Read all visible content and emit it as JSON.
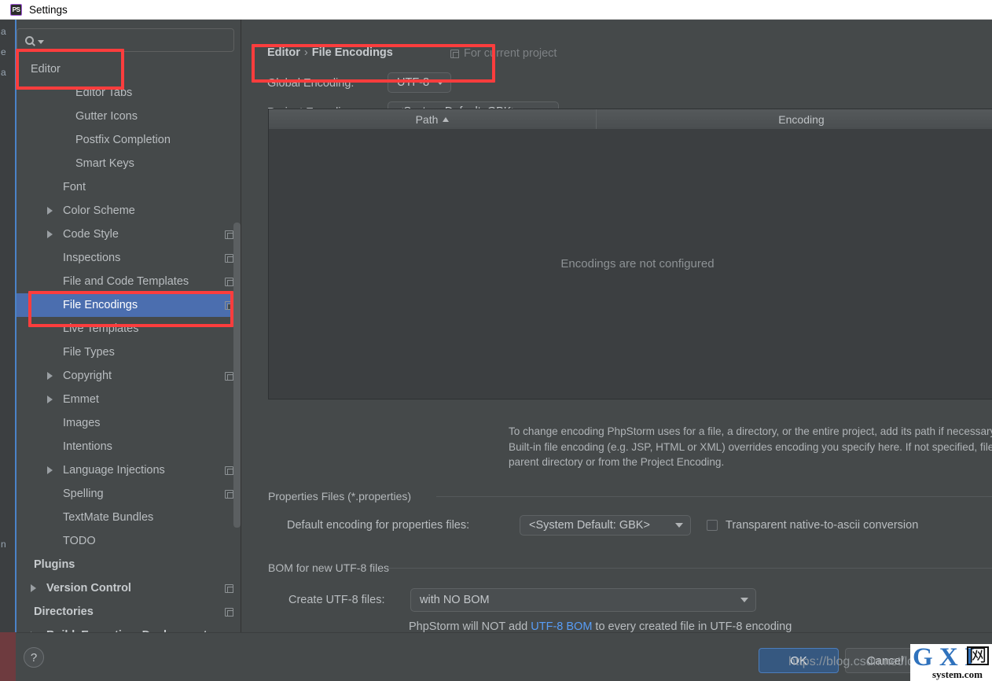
{
  "window": {
    "title": "Settings",
    "app_icon": "phpstorm-ps-icon"
  },
  "search": {
    "value": "",
    "placeholder": "",
    "icon": "search-icon"
  },
  "sidebar": {
    "items": [
      {
        "label": "Editor",
        "indent": 18,
        "bold": false,
        "arrow": false,
        "copy": false,
        "selected": false
      },
      {
        "label": "Editor Tabs",
        "indent": 75,
        "bold": false,
        "arrow": false,
        "copy": false,
        "selected": false
      },
      {
        "label": "Gutter Icons",
        "indent": 75,
        "bold": false,
        "arrow": false,
        "copy": false,
        "selected": false
      },
      {
        "label": "Postfix Completion",
        "indent": 75,
        "bold": false,
        "arrow": false,
        "copy": false,
        "selected": false
      },
      {
        "label": "Smart Keys",
        "indent": 75,
        "bold": false,
        "arrow": false,
        "copy": false,
        "selected": false
      },
      {
        "label": "Font",
        "indent": 59,
        "bold": false,
        "arrow": false,
        "copy": false,
        "selected": false
      },
      {
        "label": "Color Scheme",
        "indent": 59,
        "bold": false,
        "arrow": true,
        "copy": false,
        "selected": false
      },
      {
        "label": "Code Style",
        "indent": 59,
        "bold": false,
        "arrow": true,
        "copy": true,
        "selected": false
      },
      {
        "label": "Inspections",
        "indent": 59,
        "bold": false,
        "arrow": false,
        "copy": true,
        "selected": false
      },
      {
        "label": "File and Code Templates",
        "indent": 59,
        "bold": false,
        "arrow": false,
        "copy": true,
        "selected": false
      },
      {
        "label": "File Encodings",
        "indent": 59,
        "bold": false,
        "arrow": false,
        "copy": true,
        "selected": true
      },
      {
        "label": "Live Templates",
        "indent": 59,
        "bold": false,
        "arrow": false,
        "copy": false,
        "selected": false
      },
      {
        "label": "File Types",
        "indent": 59,
        "bold": false,
        "arrow": false,
        "copy": false,
        "selected": false
      },
      {
        "label": "Copyright",
        "indent": 59,
        "bold": false,
        "arrow": true,
        "copy": true,
        "selected": false
      },
      {
        "label": "Emmet",
        "indent": 59,
        "bold": false,
        "arrow": true,
        "copy": false,
        "selected": false
      },
      {
        "label": "Images",
        "indent": 59,
        "bold": false,
        "arrow": false,
        "copy": false,
        "selected": false
      },
      {
        "label": "Intentions",
        "indent": 59,
        "bold": false,
        "arrow": false,
        "copy": false,
        "selected": false
      },
      {
        "label": "Language Injections",
        "indent": 59,
        "bold": false,
        "arrow": true,
        "copy": true,
        "selected": false
      },
      {
        "label": "Spelling",
        "indent": 59,
        "bold": false,
        "arrow": false,
        "copy": true,
        "selected": false
      },
      {
        "label": "TextMate Bundles",
        "indent": 59,
        "bold": false,
        "arrow": false,
        "copy": false,
        "selected": false
      },
      {
        "label": "TODO",
        "indent": 59,
        "bold": false,
        "arrow": false,
        "copy": false,
        "selected": false
      },
      {
        "label": "Plugins",
        "indent": 22,
        "bold": true,
        "arrow": false,
        "copy": false,
        "selected": false
      },
      {
        "label": "Version Control",
        "indent": 38,
        "bold": true,
        "arrow": true,
        "copy": true,
        "selected": false
      },
      {
        "label": "Directories",
        "indent": 22,
        "bold": true,
        "arrow": false,
        "copy": true,
        "selected": false
      },
      {
        "label": "Build, Execution, Deployment",
        "indent": 38,
        "bold": true,
        "arrow": true,
        "copy": false,
        "selected": false
      }
    ]
  },
  "main": {
    "breadcrumb": {
      "parent": "Editor",
      "separator": "›",
      "current": "File Encodings"
    },
    "for_current_project": "For current project",
    "global_encoding": {
      "label": "Global Encoding:",
      "value": "UTF-8"
    },
    "project_encoding": {
      "label": "Project Encoding:",
      "value": "<System Default: GBK>"
    },
    "table": {
      "columns": [
        "Path",
        "Encoding"
      ],
      "sort_column": "Path",
      "sort_direction": "ascending",
      "rows": [],
      "empty_message": "Encodings are not configured"
    },
    "toolbar": {
      "add": "+",
      "remove": "−",
      "edit": "pencil"
    },
    "description": "To change encoding PhpStorm uses for a file, a directory, or the entire project, add its path if necessary and then select encoding from the encoding list. Built-in file encoding (e.g. JSP, HTML or XML) overrides encoding you specify here. If not specified, files and directories inherit encoding settings from the parent directory or from the Project Encoding.",
    "properties_section": {
      "title": "Properties Files (*.properties)",
      "default_encoding_label": "Default encoding for properties files:",
      "default_encoding_value": "<System Default: GBK>",
      "transparent_checkbox_label": "Transparent native-to-ascii conversion",
      "transparent_checkbox_checked": false
    },
    "bom_section": {
      "title": "BOM for new UTF-8 files",
      "create_label": "Create UTF-8 files:",
      "create_value": "with NO BOM",
      "hint_prefix": "PhpStorm will NOT add ",
      "hint_link": "UTF-8 BOM",
      "hint_suffix": " to every created file in UTF-8 encoding"
    }
  },
  "footer": {
    "help": "?",
    "ok": "OK",
    "cancel": "Cancel"
  },
  "watermarks": {
    "url": "https://blog.csdn.net/lq",
    "logo_main": "G X I",
    "logo_kanji": "网",
    "logo_sub": "system.com"
  },
  "colors": {
    "accent_selection": "#4b6eaf",
    "annotation_red": "#fc3d3d",
    "link_blue": "#589df6",
    "ok_button": "#365880",
    "panel_bg": "#45494a"
  }
}
